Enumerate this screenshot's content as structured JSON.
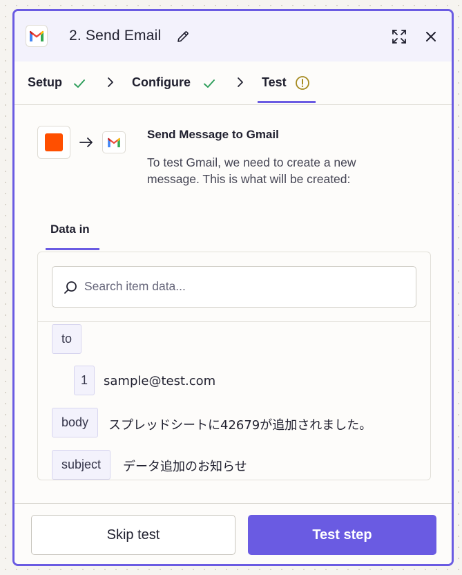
{
  "header": {
    "title": "2. Send Email",
    "icons": {
      "app": "gmail-icon",
      "edit": "pencil-icon",
      "expand": "expand-icon",
      "close": "close-icon"
    }
  },
  "steps": [
    {
      "label": "Setup",
      "status": "complete"
    },
    {
      "label": "Configure",
      "status": "complete"
    },
    {
      "label": "Test",
      "status": "warning"
    }
  ],
  "flow": {
    "title": "Send Message to Gmail",
    "description": "To test Gmail, we need to create a new message. This is what will be created:"
  },
  "tabs": {
    "data_in": "Data in"
  },
  "search": {
    "placeholder": "Search item data..."
  },
  "data": {
    "to_key": "to",
    "to_index": "1",
    "to_value": "sample@test.com",
    "body_key": "body",
    "body_value": "スプレッドシートに42679が追加されました。",
    "subject_key": "subject",
    "subject_value": "データ追加のお知らせ"
  },
  "footer": {
    "skip_label": "Skip test",
    "test_label": "Test step"
  },
  "colors": {
    "accent": "#6a5be2",
    "success": "#2e9e5b",
    "warning": "#a58a1f",
    "source_app": "#ff4f00"
  }
}
